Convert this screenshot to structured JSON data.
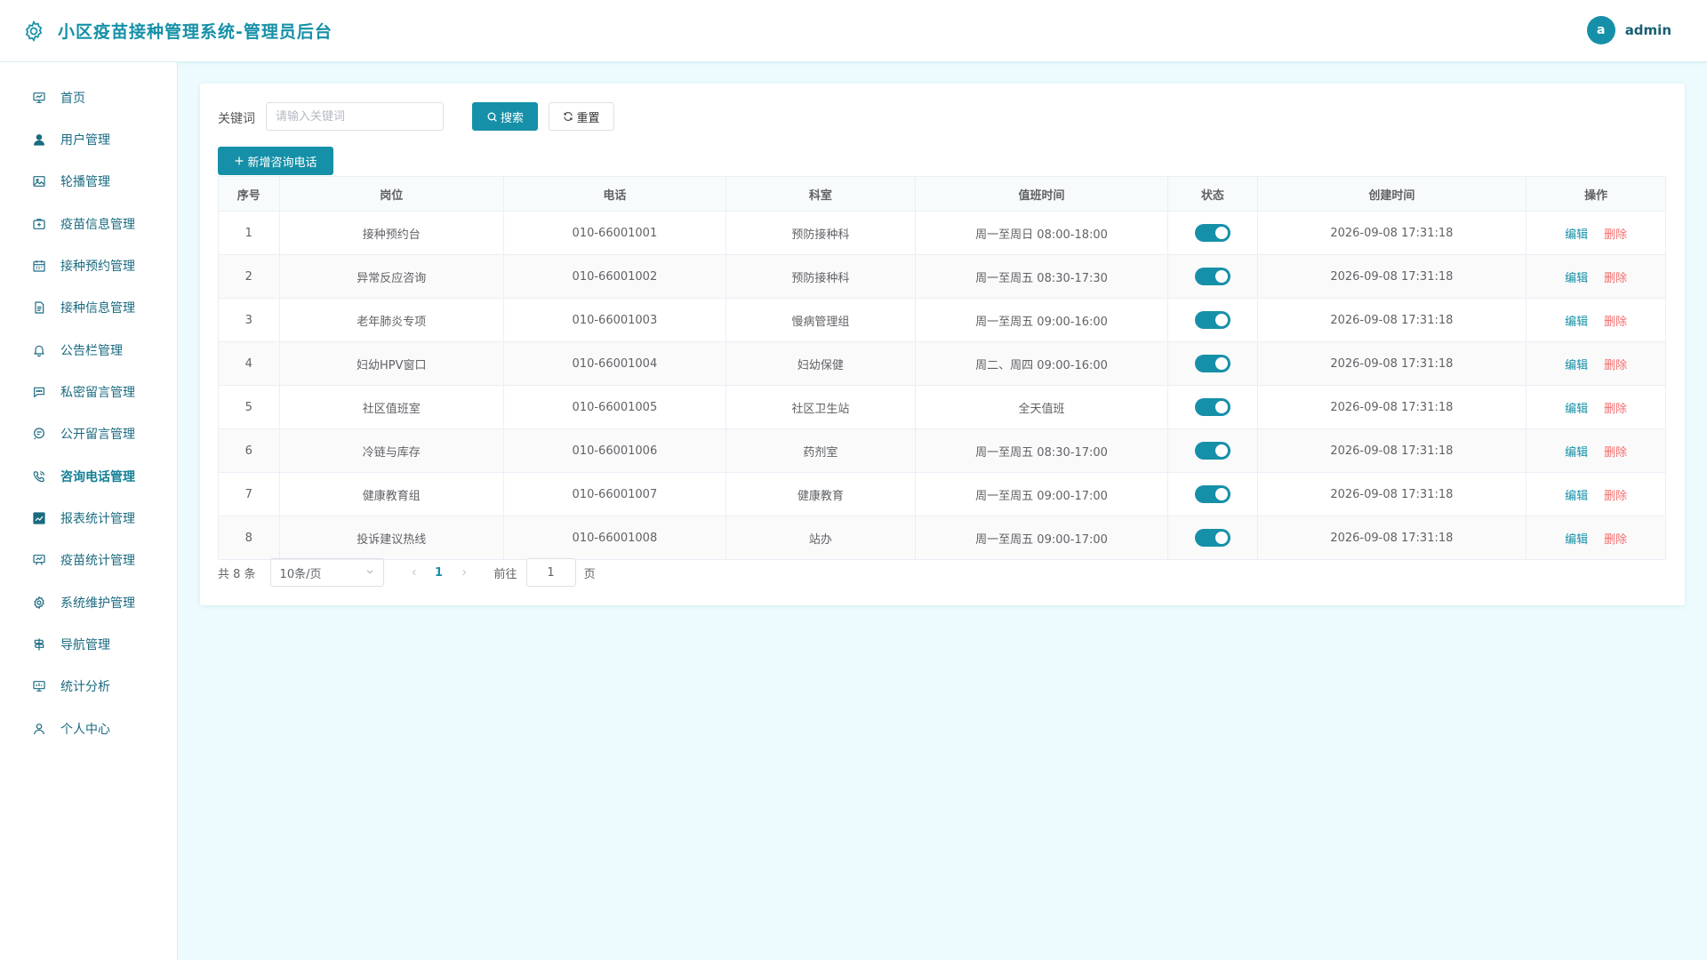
{
  "app": {
    "title": "小区疫苗接种管理系统-管理员后台"
  },
  "user": {
    "avatar_letter": "a",
    "name": "admin"
  },
  "colors": {
    "primary": "#1690a8",
    "danger": "#f56c6c",
    "background": "#edfbfe"
  },
  "sidebar": {
    "active_index": 9,
    "items": [
      {
        "label": "首页",
        "icon": "presentation-chart-icon"
      },
      {
        "label": "用户管理",
        "icon": "user-icon"
      },
      {
        "label": "轮播管理",
        "icon": "image-icon"
      },
      {
        "label": "疫苗信息管理",
        "icon": "medical-box-icon"
      },
      {
        "label": "接种预约管理",
        "icon": "calendar-icon"
      },
      {
        "label": "接种信息管理",
        "icon": "document-icon"
      },
      {
        "label": "公告栏管理",
        "icon": "bell-icon"
      },
      {
        "label": "私密留言管理",
        "icon": "chat-dots-icon"
      },
      {
        "label": "公开留言管理",
        "icon": "chat-lines-icon"
      },
      {
        "label": "咨询电话管理",
        "icon": "phone-icon"
      },
      {
        "label": "报表统计管理",
        "icon": "line-chart-icon"
      },
      {
        "label": "疫苗统计管理",
        "icon": "board-chart-icon"
      },
      {
        "label": "系统维护管理",
        "icon": "gear-icon"
      },
      {
        "label": "导航管理",
        "icon": "signpost-icon"
      },
      {
        "label": "统计分析",
        "icon": "analysis-icon"
      },
      {
        "label": "个人中心",
        "icon": "user-outline-icon"
      }
    ]
  },
  "search": {
    "label": "关键词",
    "placeholder": "请输入关键词",
    "value": "",
    "search_button": "搜索",
    "reset_button": "重置",
    "add_button": "新增咨询电话"
  },
  "table": {
    "columns": [
      "序号",
      "岗位",
      "电话",
      "科室",
      "值班时间",
      "状态",
      "创建时间",
      "操作"
    ],
    "edit_label": "编辑",
    "delete_label": "删除",
    "rows": [
      {
        "index": "1",
        "post": "接种预约台",
        "phone": "010-66001001",
        "dept": "预防接种科",
        "duty": "周一至周日 08:00-18:00",
        "enabled": true,
        "created": "2026-09-08 17:31:18"
      },
      {
        "index": "2",
        "post": "异常反应咨询",
        "phone": "010-66001002",
        "dept": "预防接种科",
        "duty": "周一至周五 08:30-17:30",
        "enabled": true,
        "created": "2026-09-08 17:31:18"
      },
      {
        "index": "3",
        "post": "老年肺炎专项",
        "phone": "010-66001003",
        "dept": "慢病管理组",
        "duty": "周一至周五 09:00-16:00",
        "enabled": true,
        "created": "2026-09-08 17:31:18"
      },
      {
        "index": "4",
        "post": "妇幼HPV窗口",
        "phone": "010-66001004",
        "dept": "妇幼保健",
        "duty": "周二、周四 09:00-16:00",
        "enabled": true,
        "created": "2026-09-08 17:31:18"
      },
      {
        "index": "5",
        "post": "社区值班室",
        "phone": "010-66001005",
        "dept": "社区卫生站",
        "duty": "全天值班",
        "enabled": true,
        "created": "2026-09-08 17:31:18"
      },
      {
        "index": "6",
        "post": "冷链与库存",
        "phone": "010-66001006",
        "dept": "药剂室",
        "duty": "周一至周五 08:30-17:00",
        "enabled": true,
        "created": "2026-09-08 17:31:18"
      },
      {
        "index": "7",
        "post": "健康教育组",
        "phone": "010-66001007",
        "dept": "健康教育",
        "duty": "周一至周五 09:00-17:00",
        "enabled": true,
        "created": "2026-09-08 17:31:18"
      },
      {
        "index": "8",
        "post": "投诉建议热线",
        "phone": "010-66001008",
        "dept": "站办",
        "duty": "周一至周五 09:00-17:00",
        "enabled": true,
        "created": "2026-09-08 17:31:18"
      }
    ]
  },
  "pagination": {
    "total_text": "共 8 条",
    "page_size": "10条/页",
    "current_page": "1",
    "goto_label": "前往",
    "goto_value": "1",
    "page_unit": "页"
  }
}
